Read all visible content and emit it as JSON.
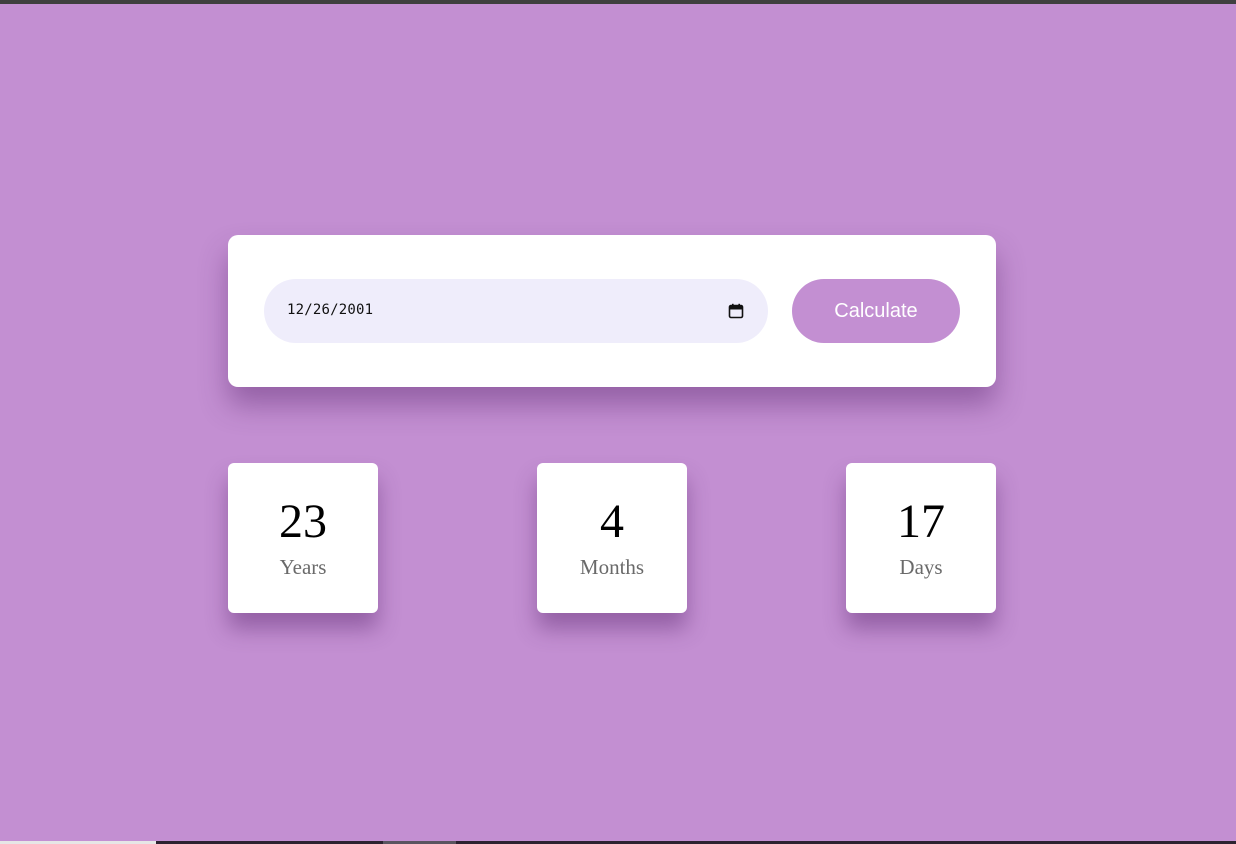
{
  "form": {
    "date_value": "12/26/2001",
    "calendar_icon": "calendar-icon",
    "calculate_label": "Calculate"
  },
  "results": {
    "years": {
      "value": "23",
      "label": "Years"
    },
    "months": {
      "value": "4",
      "label": "Months"
    },
    "days": {
      "value": "17",
      "label": "Days"
    }
  },
  "colors": {
    "background": "#c38fd2",
    "card": "#ffffff",
    "date_field": "#efedfb",
    "button": "#c38fd2",
    "button_text": "#ffffff",
    "label_text": "#6a6a6a"
  }
}
